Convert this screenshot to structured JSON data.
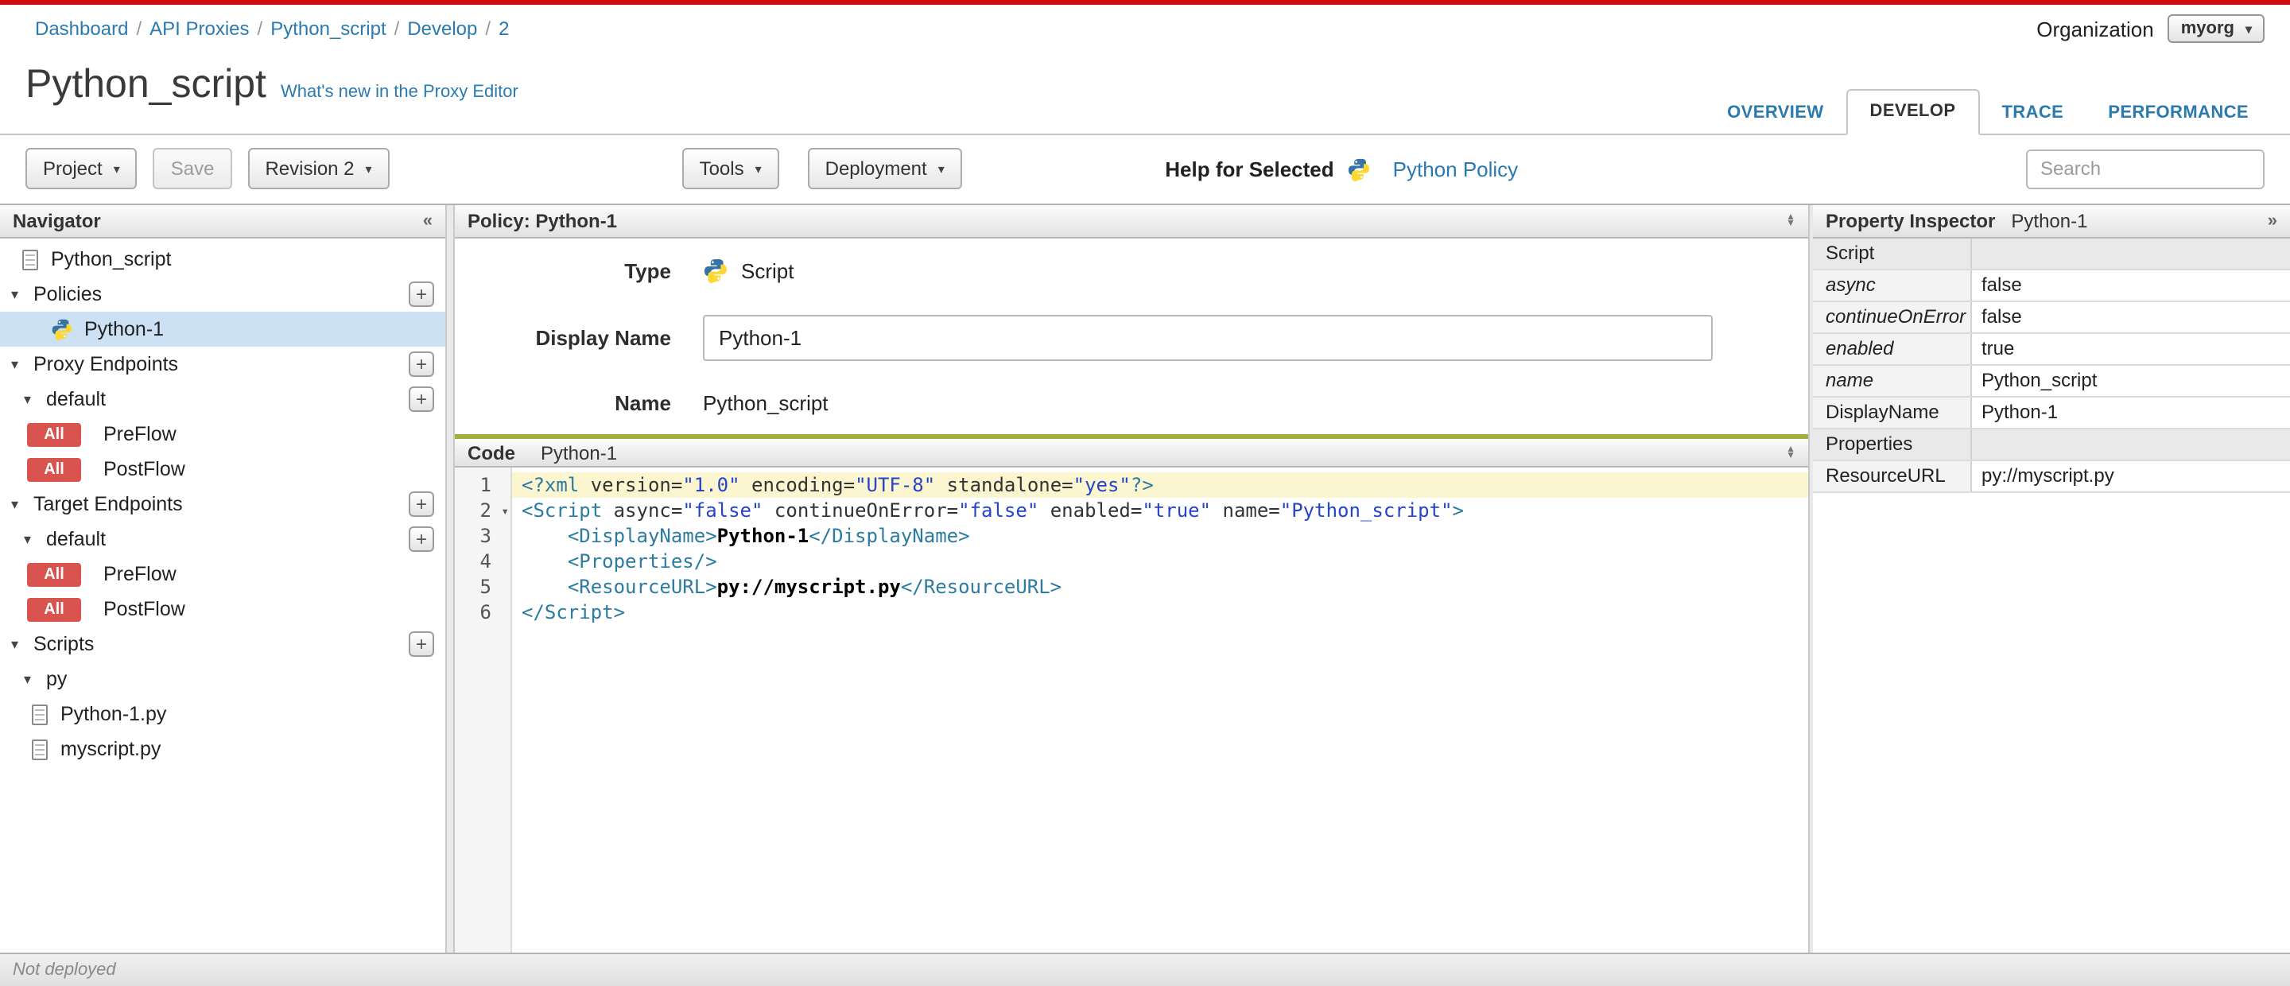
{
  "breadcrumb": {
    "sep": "/",
    "items": [
      "Dashboard",
      "API Proxies",
      "Python_script",
      "Develop",
      "2"
    ]
  },
  "org": {
    "label": "Organization",
    "value": "myorg"
  },
  "title": {
    "text": "Python_script",
    "whats_new": "What's new in the Proxy Editor"
  },
  "tabs": {
    "overview": "OVERVIEW",
    "develop": "DEVELOP",
    "trace": "TRACE",
    "performance": "PERFORMANCE"
  },
  "toolbar": {
    "project": "Project",
    "save": "Save",
    "revision": "Revision 2",
    "tools": "Tools",
    "deployment": "Deployment",
    "help_label": "Help for Selected",
    "help_link": "Python Policy",
    "search_placeholder": "Search"
  },
  "navigator": {
    "title": "Navigator",
    "root": "Python_script",
    "policies": "Policies",
    "policy": "Python-1",
    "proxy_endpoints": "Proxy Endpoints",
    "default": "default",
    "all": "All",
    "preflow": "PreFlow",
    "postflow": "PostFlow",
    "target_endpoints": "Target Endpoints",
    "scripts": "Scripts",
    "py": "py",
    "file1": "Python-1.py",
    "file2": "myscript.py"
  },
  "policy": {
    "header": "Policy: Python-1",
    "type_label": "Type",
    "type_value": "Script",
    "display_name_label": "Display Name",
    "display_name_value": "Python-1",
    "name_label": "Name",
    "name_value": "Python_script"
  },
  "code": {
    "label": "Code",
    "title": "Python-1",
    "lines": [
      {
        "n": "1",
        "hl": true,
        "tokens": [
          [
            "tag",
            "<?xml"
          ],
          [
            "plain",
            " version="
          ],
          [
            "str",
            "\"1.0\""
          ],
          [
            "plain",
            " encoding="
          ],
          [
            "str",
            "\"UTF-8\""
          ],
          [
            "plain",
            " standalone="
          ],
          [
            "str",
            "\"yes\""
          ],
          [
            "tag",
            "?>"
          ]
        ]
      },
      {
        "n": "2",
        "fold": true,
        "tokens": [
          [
            "tag",
            "<Script"
          ],
          [
            "plain",
            " async="
          ],
          [
            "str",
            "\"false\""
          ],
          [
            "plain",
            " continueOnError="
          ],
          [
            "str",
            "\"false\""
          ],
          [
            "plain",
            " enabled="
          ],
          [
            "str",
            "\"true\""
          ],
          [
            "plain",
            " name="
          ],
          [
            "str",
            "\"Python_script\""
          ],
          [
            "tag",
            ">"
          ]
        ]
      },
      {
        "n": "3",
        "tokens": [
          [
            "plain",
            "    "
          ],
          [
            "tag",
            "<DisplayName>"
          ],
          [
            "text",
            "Python-1"
          ],
          [
            "tag",
            "</DisplayName>"
          ]
        ]
      },
      {
        "n": "4",
        "tokens": [
          [
            "plain",
            "    "
          ],
          [
            "tag",
            "<Properties/>"
          ]
        ]
      },
      {
        "n": "5",
        "tokens": [
          [
            "plain",
            "    "
          ],
          [
            "tag",
            "<ResourceURL>"
          ],
          [
            "text",
            "py://myscript.py"
          ],
          [
            "tag",
            "</ResourceURL>"
          ]
        ]
      },
      {
        "n": "6",
        "tokens": [
          [
            "tag",
            "</Script>"
          ]
        ]
      }
    ]
  },
  "inspector": {
    "title": "Property Inspector",
    "subtitle": "Python-1",
    "rows": [
      {
        "name": "Script",
        "type": "section"
      },
      {
        "name": "async",
        "value": "false",
        "italic": true
      },
      {
        "name": "continueOnError",
        "value": "false",
        "italic": true
      },
      {
        "name": "enabled",
        "value": "true",
        "italic": true
      },
      {
        "name": "name",
        "value": "Python_script",
        "italic": true
      },
      {
        "name": "DisplayName",
        "value": "Python-1"
      },
      {
        "name": "Properties",
        "type": "section"
      },
      {
        "name": "ResourceURL",
        "value": "py://myscript.py"
      }
    ]
  },
  "status": {
    "text": "Not deployed"
  }
}
